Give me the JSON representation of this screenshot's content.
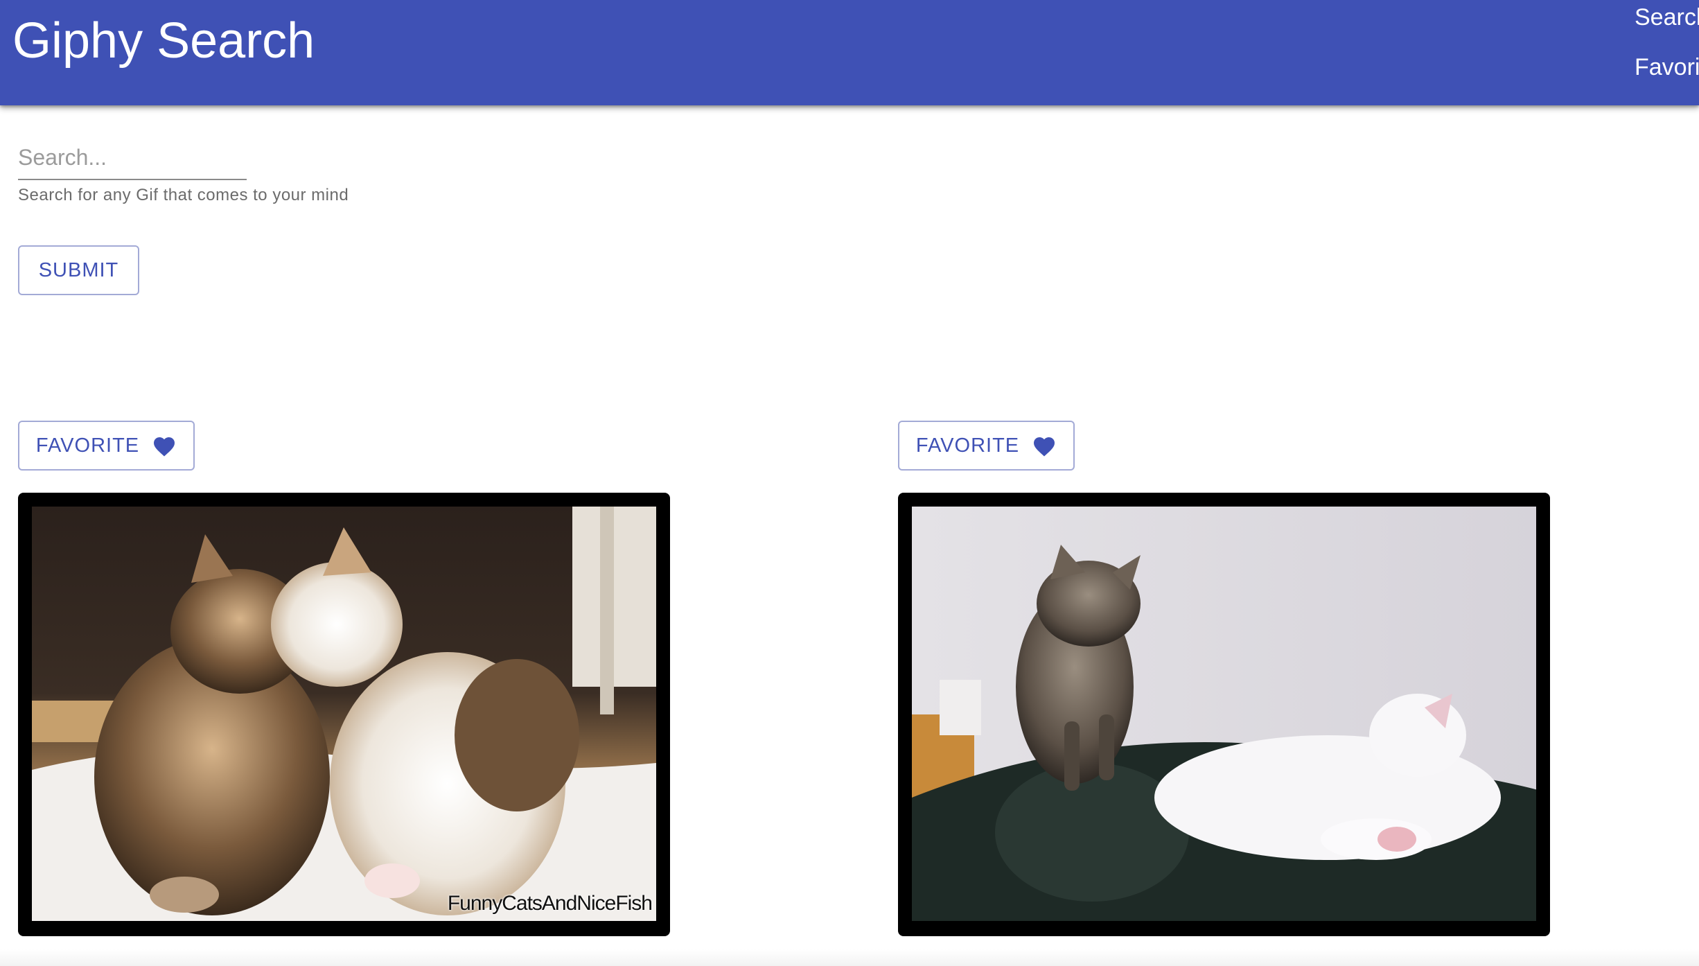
{
  "appbar": {
    "title": "Giphy Search",
    "nav": {
      "search_label": "Search",
      "favorites_label": "Favorites"
    },
    "color": "#3f51b5"
  },
  "search": {
    "placeholder": "Search...",
    "value": "",
    "helper_text": "Search for any Gif that comes to your mind",
    "submit_label": "SUBMIT"
  },
  "results": [
    {
      "favorite_label": "FAVORITE",
      "favorite_icon": "heart-icon",
      "watermark": "FunnyCatsAndNiceFish"
    },
    {
      "favorite_label": "FAVORITE",
      "favorite_icon": "heart-icon"
    }
  ]
}
